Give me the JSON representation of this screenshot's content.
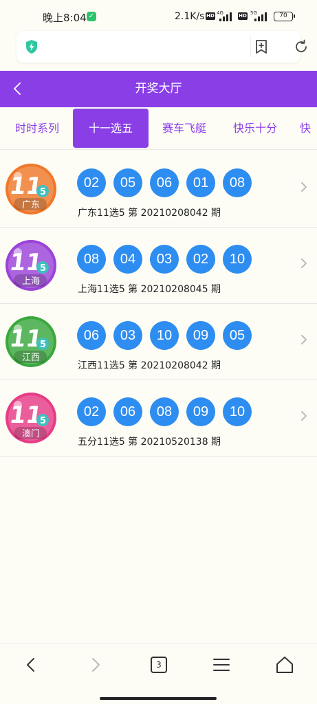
{
  "status_bar": {
    "time": "晚上8:04",
    "app_icon": "wechat-icon",
    "speed": "2.1K/s",
    "network1": "4G",
    "network2": "5G",
    "hd1": "HD",
    "hd2": "HD",
    "battery": "70"
  },
  "url_bar": {
    "shield_icon": "lightning-shield-icon",
    "accent": "#2ec7a0"
  },
  "header": {
    "title": "开奖大厅",
    "color": "#8a3fe6"
  },
  "tabs": [
    {
      "label": "时时系列",
      "active": false
    },
    {
      "label": "十一选五",
      "active": true
    },
    {
      "label": "赛车飞艇",
      "active": false
    },
    {
      "label": "快乐十分",
      "active": false
    },
    {
      "label": "快",
      "active": false
    }
  ],
  "rows": [
    {
      "region": "广东",
      "logo_color": "#f0782a",
      "balls": [
        "02",
        "05",
        "06",
        "01",
        "08"
      ],
      "caption": "广东11选5 第 20210208042 期"
    },
    {
      "region": "上海",
      "logo_color": "#9b43d8",
      "balls": [
        "08",
        "04",
        "03",
        "02",
        "10"
      ],
      "caption": "上海11选5 第 20210208045 期"
    },
    {
      "region": "江西",
      "logo_color": "#3aa83d",
      "balls": [
        "06",
        "03",
        "10",
        "09",
        "05"
      ],
      "caption": "江西11选5 第 20210208042 期"
    },
    {
      "region": "澳门",
      "logo_color": "#e63c86",
      "balls": [
        "02",
        "06",
        "08",
        "09",
        "10"
      ],
      "caption": "五分11选5 第 20210520138 期"
    }
  ],
  "ball_color": "#2e8df0",
  "bottom_nav": {
    "tab_count": "3"
  }
}
